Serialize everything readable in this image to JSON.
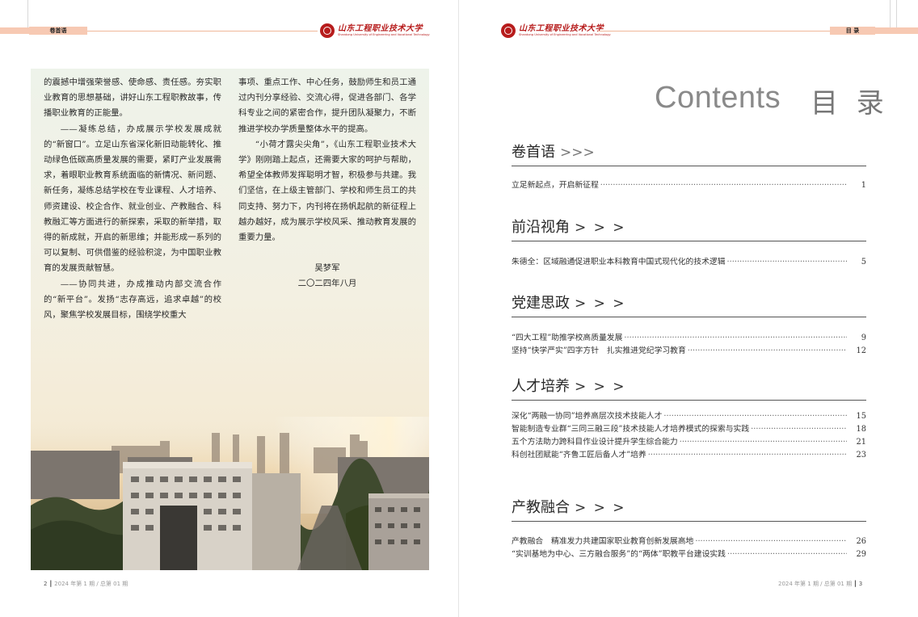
{
  "left_page": {
    "header_tag": "卷首语",
    "col1": [
      {
        "text": "的震撼中增强荣誉感、使命感、责任感。夯实职业教育的思想基础，讲好山东工程职教故事，传播职业教育的正能量。",
        "indent": false
      },
      {
        "text": "——凝练总结，办成展示学校发展成就的“新窗口”。立足山东省深化新旧动能转化、推动绿色低碳高质量发展的需要，紧盯产业发展需求，着眼职业教育系统面临的新情况、新问题、新任务，凝练总结学校在专业课程、人才培养、师资建设、校企合作、就业创业、产教融合、科教融汇等方面进行的新探索，采取的新举措，取得的新成就，开启的新思维；并能形成一系列的可以复制、可供借鉴的经验积淀，为中国职业教育的发展贡献智慧。",
        "indent": true
      },
      {
        "text": "——协同共进，办成推动内部交流合作的“新平台”。发扬“志存高远，追求卓越”的校风，聚焦学校发展目标，围绕学校重大",
        "indent": true
      }
    ],
    "col2": [
      {
        "text": "事项、重点工作、中心任务，鼓励师生和员工通过内刊分享经验、交流心得，促进各部门、各学科专业之间的紧密合作，提升团队凝聚力，不断推进学校办学质量整体水平的提高。",
        "indent": false
      },
      {
        "text": "“小荷才露尖尖角”，《山东工程职业技术大学》刚刚踏上起点，还需要大家的呵护与帮助，希望全体教师发挥聪明才智，积极参与共建。我们坚信，在上级主管部门、学校和师生员工的共同支持、努力下，内刊将在扬帆起航的新征程上越办越好，成为展示学校风采、推动教育发展的重要力量。",
        "indent": true
      }
    ],
    "author": "吴梦军",
    "date": "二〇二四年八月",
    "footer_page": "2",
    "footer_issue": "2024 年第 1 期 / 总第 01 期"
  },
  "logo": {
    "cn": "山东工程职业技术大学",
    "en": "Shandong University of Engineering and Vocational Technology"
  },
  "right_page": {
    "header_tag": "目 录",
    "title_en": "Contents",
    "title_cn": "目 录",
    "footer_issue": "2024 年第 1 期 / 总第 01 期",
    "footer_page": "3",
    "sections": [
      {
        "title": "卷首语",
        "arrows": ">>>",
        "entries": [
          {
            "title": "立足新起点，开启新征程",
            "page": "1"
          }
        ]
      },
      {
        "title": "前沿视角",
        "arrows": "> > >",
        "entries": [
          {
            "title": "朱德全：区域融通促进职业本科教育中国式现代化的技术逻辑",
            "page": "5"
          }
        ]
      },
      {
        "title": "党建思政",
        "arrows": "> > >",
        "entries": [
          {
            "title": "“四大工程”助推学校高质量发展",
            "page": "9"
          },
          {
            "title": "坚持“快学严实”四字方针　扎实推进党纪学习教育",
            "page": "12"
          }
        ]
      },
      {
        "title": "人才培养",
        "arrows": "> > >",
        "entries": [
          {
            "title": "深化“两融一协同”培养高层次技术技能人才",
            "page": "15"
          },
          {
            "title": "智能制造专业群“三同三融三段”技术技能人才培养模式的探索与实践",
            "page": "18"
          },
          {
            "title": "五个方法助力跨科目作业设计提升学生综合能力",
            "page": "21"
          },
          {
            "title": "科创社团赋能“齐鲁工匠后备人才”培养",
            "page": "23"
          }
        ]
      },
      {
        "title": "产教融合",
        "arrows": "> > >",
        "entries": [
          {
            "title": "产教融合　精准发力共建国家职业教育创新发展高地 ",
            "page": "26"
          },
          {
            "title": "“实训基地为中心、三方融合服务”的“两体”职教平台建设实践",
            "page": "29"
          }
        ]
      }
    ]
  },
  "colors": {
    "accent_peach": "#f7c9b3",
    "brand_red": "#b71c1c"
  }
}
